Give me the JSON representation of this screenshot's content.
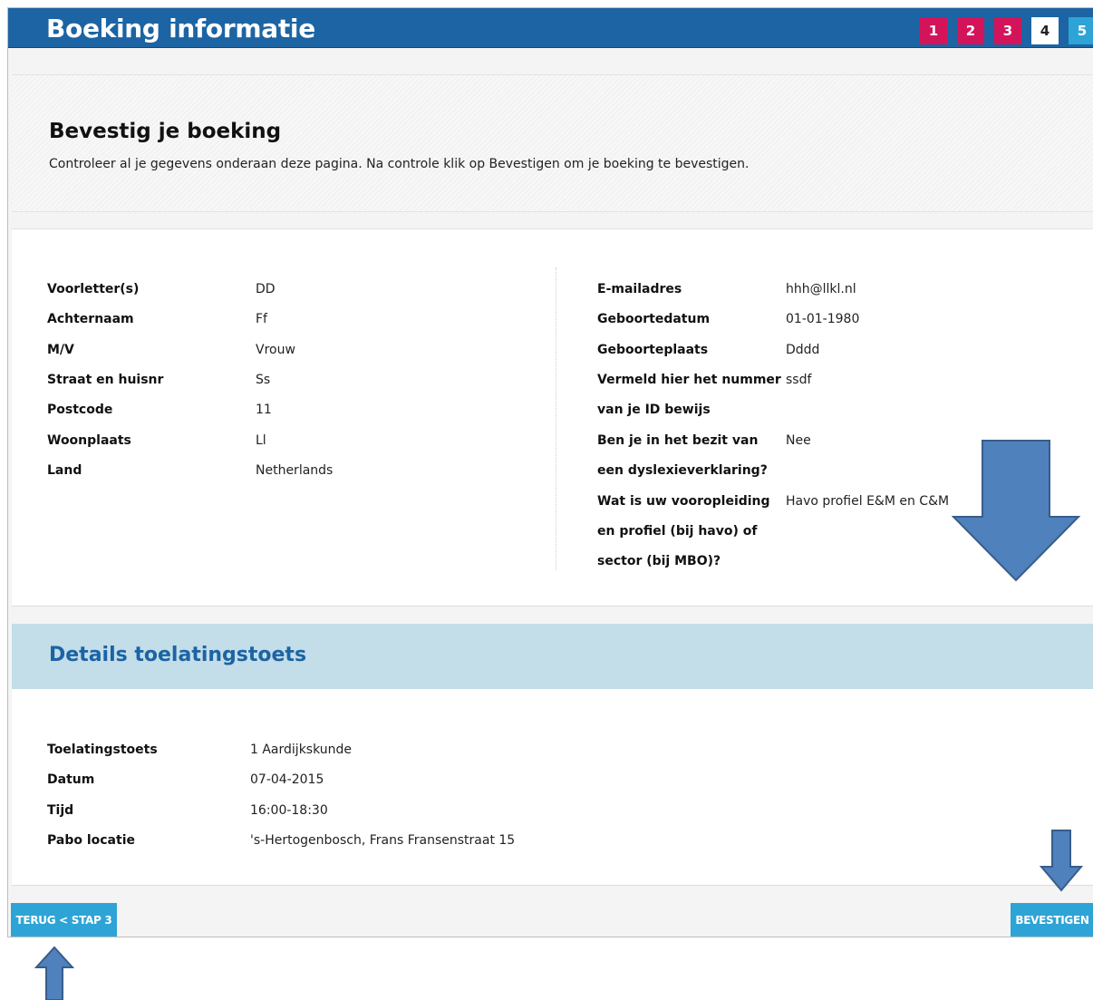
{
  "header": {
    "title": "Boeking informatie",
    "steps": [
      {
        "label": "1",
        "state": "done"
      },
      {
        "label": "2",
        "state": "done"
      },
      {
        "label": "3",
        "state": "done"
      },
      {
        "label": "4",
        "state": "current"
      },
      {
        "label": "5",
        "state": "todo"
      }
    ]
  },
  "intro": {
    "heading": "Bevestig je boeking",
    "text": "Controleer al je gegevens onderaan deze pagina. Na controle klik op Bevestigen om je boeking te bevestigen."
  },
  "personal": {
    "left": [
      {
        "label": "Voorletter(s)",
        "value": "DD"
      },
      {
        "label": "Achternaam",
        "value": "Ff"
      },
      {
        "label": "M/V",
        "value": "Vrouw"
      },
      {
        "label": "Straat en huisnr",
        "value": "Ss"
      },
      {
        "label": "Postcode",
        "value": "11"
      },
      {
        "label": "Woonplaats",
        "value": "Ll"
      },
      {
        "label": "Land",
        "value": "Netherlands"
      }
    ],
    "right": [
      {
        "label": "E-mailadres",
        "value": "hhh@llkl.nl"
      },
      {
        "label": "Geboortedatum",
        "value": "01-01-1980"
      },
      {
        "label": "Geboorteplaats",
        "value": "Dddd"
      },
      {
        "label": "Vermeld hier het nummer",
        "value": "ssdf"
      },
      {
        "label": "van je ID bewijs",
        "value": ""
      },
      {
        "label": "Ben je in het bezit van",
        "value": "Nee"
      },
      {
        "label": "een dyslexieverklaring?",
        "value": ""
      },
      {
        "label": "Wat is uw vooropleiding",
        "value": "Havo profiel E&M en C&M"
      },
      {
        "label": "en profiel (bij havo) of",
        "value": ""
      },
      {
        "label": "sector (bij MBO)?",
        "value": ""
      }
    ]
  },
  "details": {
    "heading": "Details toelatingstoets",
    "rows": [
      {
        "label": "Toelatingstoets",
        "value": "1 Aardijkskunde"
      },
      {
        "label": "Datum",
        "value": "07-04-2015"
      },
      {
        "label": "Tijd",
        "value": "16:00-18:30"
      },
      {
        "label": "Pabo locatie",
        "value": "'s-Hertogenbosch, Frans Fransenstraat 15"
      }
    ]
  },
  "buttons": {
    "back": "TERUG < STAP 3",
    "confirm": "BEVESTIGEN"
  },
  "colors": {
    "header": "#1c64a3",
    "step_done": "#d4145a",
    "step_todo": "#2ea4d6",
    "button": "#2ea4d6",
    "details_bar": "#c3dde9",
    "annotation_arrow": "#4f81bd"
  }
}
